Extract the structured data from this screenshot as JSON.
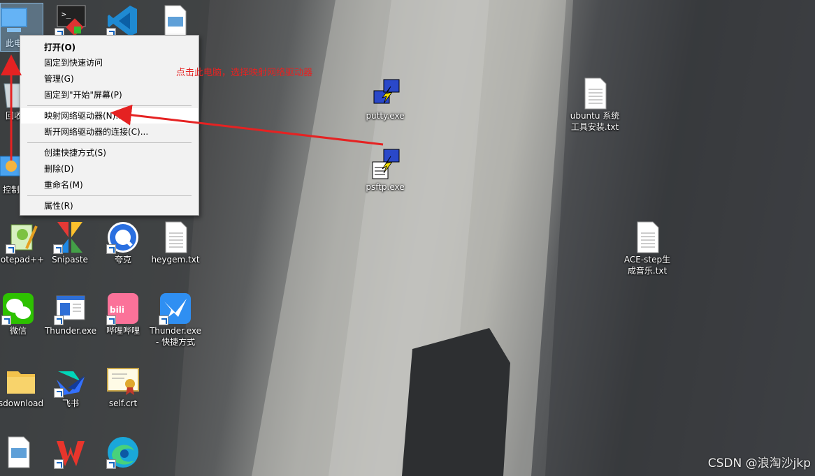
{
  "desktop_icons": [
    {
      "id": "this-pc",
      "label": "此电",
      "icon": "monitor-icon"
    },
    {
      "id": "terminal",
      "label": "",
      "icon": "terminal-icon"
    },
    {
      "id": "vscode",
      "label": "",
      "icon": "vscode-icon"
    },
    {
      "id": "image-file",
      "label": "",
      "icon": "image-file-icon"
    },
    {
      "id": "recycle-bin",
      "label": "回收",
      "icon": "recycle-bin-icon"
    },
    {
      "id": "control-panel",
      "label": "控制",
      "icon": "control-panel-icon"
    },
    {
      "id": "putty",
      "label": "putty.exe",
      "icon": "putty-icon"
    },
    {
      "id": "psftp",
      "label": "psftp.exe",
      "icon": "psftp-icon"
    },
    {
      "id": "ubuntu-txt",
      "label": "ubuntu 系统\n工具安装.txt",
      "icon": "text-file-icon"
    },
    {
      "id": "notepadpp",
      "label": "otepad++",
      "icon": "notepadpp-icon"
    },
    {
      "id": "snipaste",
      "label": "Snipaste",
      "icon": "snipaste-icon"
    },
    {
      "id": "quark",
      "label": "夸克",
      "icon": "quark-icon"
    },
    {
      "id": "heygem",
      "label": "heygem.txt",
      "icon": "text-file-icon"
    },
    {
      "id": "ace-step",
      "label": "ACE-step生\n成音乐.txt",
      "icon": "text-file-icon"
    },
    {
      "id": "wechat",
      "label": "微信",
      "icon": "wechat-icon"
    },
    {
      "id": "thunder",
      "label": "Thunder.exe",
      "icon": "thunder-window-icon"
    },
    {
      "id": "bilibili",
      "label": "哔哩哔哩",
      "icon": "bilibili-icon"
    },
    {
      "id": "thunder-shortcut",
      "label": "Thunder.exe\n- 快捷方式",
      "icon": "thunder-bird-icon"
    },
    {
      "id": "download",
      "label": "sdownload",
      "icon": "folder-icon"
    },
    {
      "id": "feishu",
      "label": "飞书",
      "icon": "feishu-icon"
    },
    {
      "id": "selfcrt",
      "label": "self.crt",
      "icon": "certificate-icon"
    },
    {
      "id": "image-file-2",
      "label": "",
      "icon": "image-file-icon"
    },
    {
      "id": "wps",
      "label": "",
      "icon": "wps-icon"
    },
    {
      "id": "edge",
      "label": "",
      "icon": "edge-icon"
    }
  ],
  "context_menu": {
    "items": [
      {
        "label": "打开(O)",
        "bold": true
      },
      {
        "label": "固定到快速访问"
      },
      {
        "label": "管理(G)"
      },
      {
        "label": "固定到\"开始\"屏幕(P)"
      },
      {
        "label": "映射网络驱动器(N)...",
        "hover": true
      },
      {
        "label": "断开网络驱动器的连接(C)..."
      },
      {
        "label": "创建快捷方式(S)"
      },
      {
        "label": "删除(D)"
      },
      {
        "label": "重命名(M)"
      },
      {
        "label": "属性(R)"
      }
    ]
  },
  "annotation": {
    "text": "点击此电脑，选择映射网络驱动器",
    "color": "#e52222"
  },
  "watermark": "CSDN @浪淘沙jkp"
}
